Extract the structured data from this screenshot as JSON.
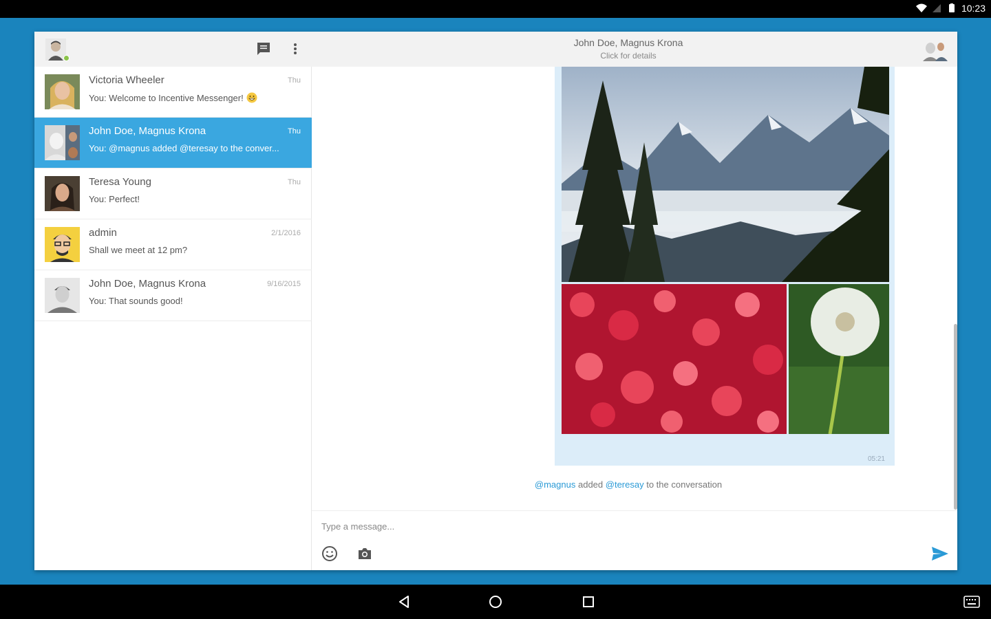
{
  "status_bar": {
    "time": "10:23"
  },
  "left_pane": {
    "conversations": [
      {
        "name": "Victoria Wheeler",
        "date": "Thu",
        "preview": "You: Welcome to Incentive Messenger!",
        "active": false
      },
      {
        "name": "John Doe, Magnus Krona",
        "date": "Thu",
        "preview": "You: @magnus added @teresay to the conver...",
        "active": true
      },
      {
        "name": "Teresa Young",
        "date": "Thu",
        "preview": "You: Perfect!",
        "active": false
      },
      {
        "name": "admin",
        "date": "2/1/2016",
        "preview": "Shall we meet at 12 pm?",
        "active": false
      },
      {
        "name": "John Doe, Magnus Krona",
        "date": "9/16/2015",
        "preview": "You: That sounds good!",
        "active": false
      }
    ]
  },
  "chat": {
    "title": "John Doe, Magnus Krona",
    "subtitle": "Click for details",
    "message_time": "05:21",
    "system_message": {
      "actor": "@magnus",
      "verb": "added",
      "target": "@teresay",
      "rest": "to the conversation"
    },
    "composer": {
      "placeholder": "Type a message..."
    }
  },
  "colors": {
    "accent": "#3aa7e0",
    "background": "#1a84bd",
    "send": "#2a9ad6",
    "online": "#8bc34a"
  }
}
